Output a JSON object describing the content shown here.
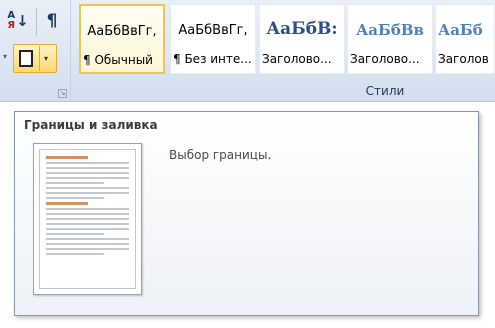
{
  "paragraph_group": {
    "sort_icon_letters": [
      "А",
      "Я"
    ],
    "pilcrow": "¶"
  },
  "styles_gallery": {
    "tiles": [
      {
        "sample": "АаБбВвГг,",
        "label": "¶ Обычный",
        "selected": true
      },
      {
        "sample": "АаБбВвГг,",
        "label": "¶ Без инте..."
      },
      {
        "sample": "АаБбВ:",
        "label": "Заголово..."
      },
      {
        "sample": "АаБбВв",
        "label": "Заголово..."
      },
      {
        "sample": "АаБб",
        "label": "Заголов"
      }
    ],
    "group_label": "Стили"
  },
  "tooltip": {
    "title": "Границы и заливка",
    "description": "Выбор границы."
  },
  "colors": {
    "ribbon_bg": "#dce6f2",
    "selected_tile_border": "#f0c35a",
    "heading_blue": "#2a4f86"
  },
  "icons": [
    "sort-az-icon",
    "pilcrow-icon",
    "borders-icon",
    "dropdown-arrow-icon",
    "dialog-launcher-icon"
  ]
}
